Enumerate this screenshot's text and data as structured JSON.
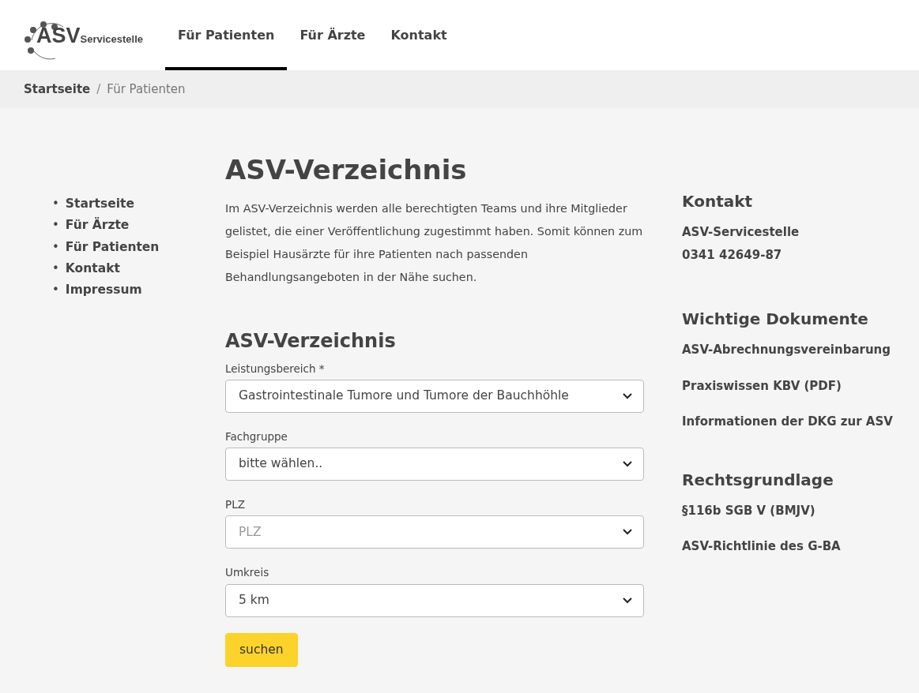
{
  "logo": {
    "mark": "ASV",
    "text": "Servicestelle"
  },
  "nav": [
    {
      "label": "Für Patienten",
      "selected": true
    },
    {
      "label": "Für Ärzte",
      "selected": false
    },
    {
      "label": "Kontakt",
      "selected": false
    }
  ],
  "breadcrumb": {
    "separator": "/",
    "items": [
      "Startseite",
      "Für Patienten"
    ]
  },
  "sidebar": {
    "bullet": "•",
    "items": [
      "Startseite",
      "Für Ärzte",
      "Für Patienten",
      "Kontakt",
      "Impressum"
    ]
  },
  "main": {
    "title": "ASV-Verzeichnis",
    "intro": "Im ASV-Verzeichnis werden alle berechtigten Teams und ihre Mitglieder gelistet, die einer Veröffentlichung zugestimmt haben. Somit können zum Beispiel Hausärzte für ihre Patienten nach passenden Behandlungsangeboten in der Nähe suchen.",
    "form": {
      "title": "ASV-Verzeichnis",
      "fields": [
        {
          "label": "Leistungsbereich *",
          "value": "Gastrointestinale Tumore und Tumore der Bauchhöhle"
        },
        {
          "label": "Fachgruppe",
          "value": "bitte wählen.."
        },
        {
          "label": "PLZ",
          "placeholder": "PLZ"
        },
        {
          "label": "Umkreis",
          "value": "5 km"
        }
      ],
      "button": "suchen"
    }
  },
  "aside": [
    {
      "title": "Kontakt",
      "kind": "text",
      "lines": [
        "ASV-Servicestelle",
        "0341 42649-87"
      ]
    },
    {
      "title": "Wichtige Dokumente",
      "kind": "links",
      "lines": [
        "ASV-Abrechnungsvereinbarung",
        "Praxiswissen KBV (PDF)",
        "Informationen der DKG zur ASV"
      ]
    },
    {
      "title": "Rechtsgrundlage",
      "kind": "links",
      "lines": [
        "§116b SGB V (BMJV)",
        "ASV-Richtlinie des G-BA"
      ]
    }
  ]
}
